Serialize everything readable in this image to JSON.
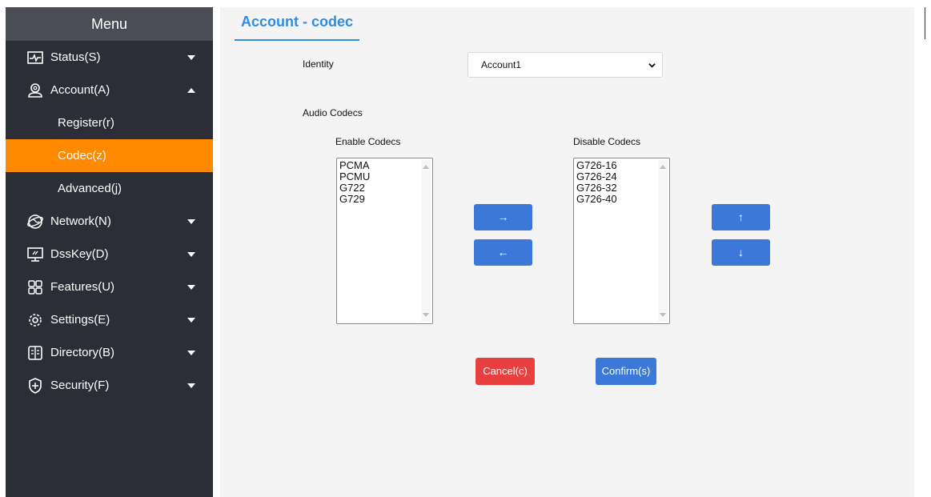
{
  "sidebar": {
    "menu_title": "Menu",
    "items": [
      {
        "label": "Status(S)",
        "icon": "status-icon"
      },
      {
        "label": "Account(A)",
        "icon": "account-icon"
      },
      {
        "label": "Network(N)",
        "icon": "network-icon"
      },
      {
        "label": "DssKey(D)",
        "icon": "dsskey-icon"
      },
      {
        "label": "Features(U)",
        "icon": "features-icon"
      },
      {
        "label": "Settings(E)",
        "icon": "settings-icon"
      },
      {
        "label": "Directory(B)",
        "icon": "directory-icon"
      },
      {
        "label": "Security(F)",
        "icon": "security-icon"
      }
    ],
    "account_sub": [
      {
        "label": "Register(r)"
      },
      {
        "label": "Codec(z)",
        "active": true
      },
      {
        "label": "Advanced(j)"
      }
    ]
  },
  "main": {
    "tab_title": "Account - codec",
    "identity_label": "Identity",
    "identity_value": "Account1",
    "audio_codecs_label": "Audio Codecs",
    "enable_label": "Enable Codecs",
    "disable_label": "Disable Codecs",
    "enabled_codecs": [
      "PCMA",
      "PCMU",
      "G722",
      "G729"
    ],
    "disabled_codecs": [
      "G726-16",
      "G726-24",
      "G726-32",
      "G726-40"
    ],
    "move_right": "→",
    "move_left": "←",
    "move_up": "↑",
    "move_down": "↓",
    "cancel_label": "Cancel(c)",
    "confirm_label": "Confirm(s)"
  },
  "colors": {
    "sidebar_bg": "#2b2e36",
    "active_item": "#ff8a00",
    "accent_blue": "#2f8de4",
    "button_blue": "#3b78d8",
    "cancel_red": "#e84040"
  }
}
